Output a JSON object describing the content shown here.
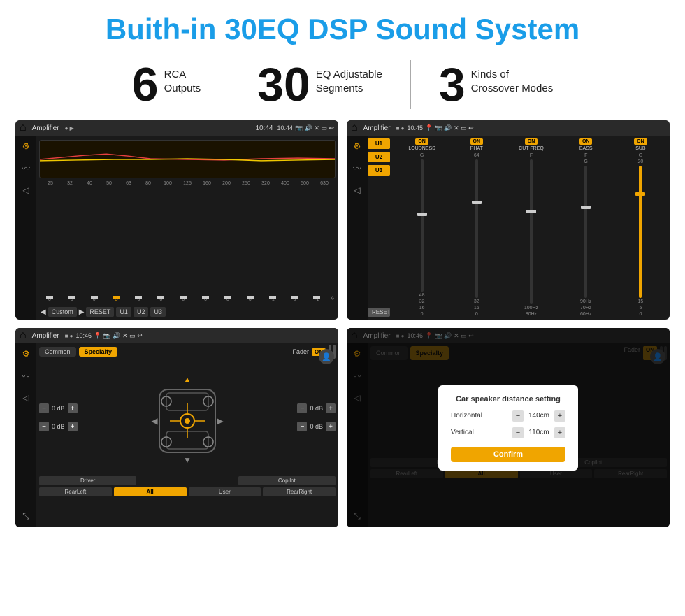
{
  "page": {
    "title": "Buith-in 30EQ DSP Sound System",
    "stats": [
      {
        "number": "6",
        "line1": "RCA",
        "line2": "Outputs"
      },
      {
        "number": "30",
        "line1": "EQ Adjustable",
        "line2": "Segments"
      },
      {
        "number": "3",
        "line1": "Kinds of",
        "line2": "Crossover Modes"
      }
    ]
  },
  "screen1": {
    "header_title": "Amplifier",
    "time": "10:44",
    "freq_labels": [
      "25",
      "32",
      "40",
      "50",
      "63",
      "80",
      "100",
      "125",
      "160",
      "200",
      "250",
      "320",
      "400",
      "500",
      "630"
    ],
    "slider_values": [
      "0",
      "0",
      "0",
      "5",
      "0",
      "0",
      "0",
      "0",
      "0",
      "0",
      "-1",
      "0",
      "-1"
    ],
    "bottom_btns": [
      "Custom",
      "RESET",
      "U1",
      "U2",
      "U3"
    ]
  },
  "screen2": {
    "header_title": "Amplifier",
    "time": "10:45",
    "presets": [
      "U1",
      "U2",
      "U3"
    ],
    "controls": [
      {
        "label": "LOUDNESS",
        "toggle": "ON"
      },
      {
        "label": "PHAT",
        "toggle": "ON"
      },
      {
        "label": "CUT FREQ",
        "toggle": "ON"
      },
      {
        "label": "BASS",
        "toggle": "ON"
      },
      {
        "label": "SUB",
        "toggle": "ON"
      }
    ],
    "reset_label": "RESET"
  },
  "screen3": {
    "header_title": "Amplifier",
    "time": "10:46",
    "tabs": [
      "Common",
      "Specialty"
    ],
    "fader_label": "Fader",
    "fader_toggle": "ON",
    "spk_rows": [
      {
        "val": "0 dB"
      },
      {
        "val": "0 dB"
      },
      {
        "val": "0 dB"
      },
      {
        "val": "0 dB"
      }
    ],
    "bottom_btns": [
      "Driver",
      "",
      "Copilot",
      "RearLeft",
      "All",
      "User",
      "RearRight"
    ]
  },
  "screen4": {
    "header_title": "Amplifier",
    "time": "10:46",
    "tabs": [
      "Common",
      "Specialty"
    ],
    "dialog": {
      "title": "Car speaker distance setting",
      "horizontal_label": "Horizontal",
      "horizontal_val": "140cm",
      "vertical_label": "Vertical",
      "vertical_val": "110cm",
      "confirm_label": "Confirm"
    },
    "bottom_btns": [
      "Driver",
      "Copilot",
      "RearLeft",
      "User",
      "RearRight"
    ]
  }
}
